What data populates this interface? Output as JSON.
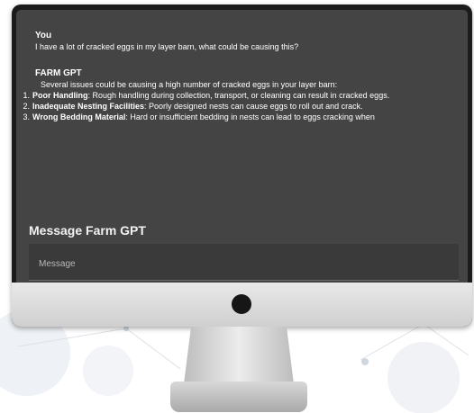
{
  "chat": {
    "user": {
      "speaker": "You",
      "text": "I have a lot of cracked eggs in my layer barn, what could be causing this?"
    },
    "assistant": {
      "speaker": "FARM GPT",
      "intro": "Several issues could be causing a high number of cracked eggs in your layer barn:",
      "causes": [
        {
          "num": "1.",
          "title": "Poor Handling",
          "text": ": Rough handling during collection, transport, or cleaning can result in cracked eggs."
        },
        {
          "num": "2.",
          "title": "Inadequate Nesting Facilities",
          "text": ": Poorly designed nests can cause eggs to roll out and crack."
        },
        {
          "num": "3.",
          "title": "Wrong Bedding Material",
          "text": ": Hard or insufficient bedding in nests can lead to eggs cracking when"
        }
      ]
    }
  },
  "composer": {
    "label": "Message Farm GPT",
    "placeholder": "Message"
  },
  "colors": {
    "screen_bg": "#444444",
    "monitor_bezel": "#1b1b1b",
    "monitor_chin": "#e0e0e0"
  }
}
